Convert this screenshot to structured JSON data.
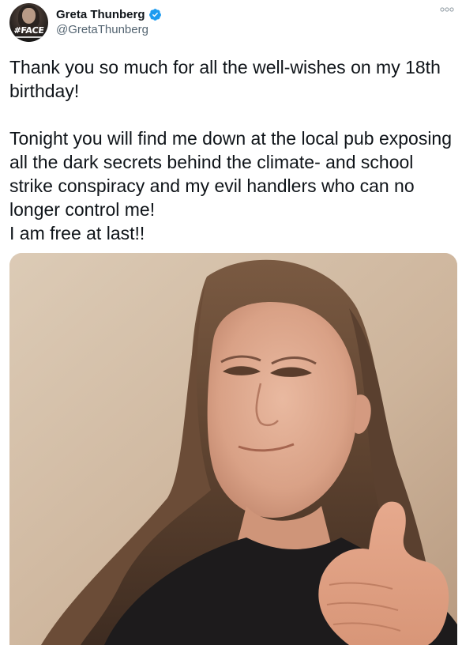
{
  "author": {
    "display_name": "Greta Thunberg",
    "handle": "@GretaThunberg",
    "avatar_badge_text": "#FACE",
    "verified": true
  },
  "tweet": {
    "lines": [
      "Thank you so much for all the well-wishes on my 18th birthday!",
      "Tonight you will find me down at the local pub exposing all the dark secrets behind the climate- and school strike conspiracy and my evil handlers who can no longer control me!",
      "I am free at last!!"
    ],
    "more_icon": "ellipsis-icon"
  },
  "colors": {
    "text": "#0f1419",
    "secondary": "#536471",
    "verified_blue": "#1d9bf0"
  }
}
